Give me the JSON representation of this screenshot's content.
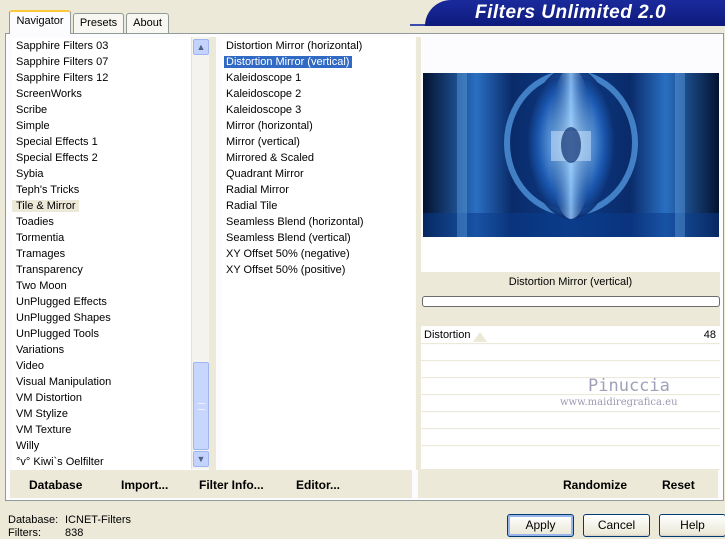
{
  "tabs": [
    {
      "label": "Navigator"
    },
    {
      "label": "Presets"
    },
    {
      "label": "About"
    }
  ],
  "banner": {
    "title": "Filters Unlimited 2.0"
  },
  "categories": [
    "Sapphire Filters 03",
    "Sapphire Filters 07",
    "Sapphire Filters 12",
    "ScreenWorks",
    "Scribe",
    "Simple",
    "Special Effects 1",
    "Special Effects 2",
    "Sybia",
    "Teph's Tricks",
    "Tile & Mirror",
    "Toadies",
    "Tormentia",
    "Tramages",
    "Transparency",
    "Two Moon",
    "UnPlugged Effects",
    "UnPlugged Shapes",
    "UnPlugged Tools",
    "Variations",
    "Video",
    "Visual Manipulation",
    "VM Distortion",
    "VM Stylize",
    "VM Texture",
    "Willy",
    "°v° Kiwi`s Oelfilter"
  ],
  "selected_category": "Tile & Mirror",
  "filters": [
    "Distortion Mirror (horizontal)",
    "Distortion Mirror (vertical)",
    "Kaleidoscope 1",
    "Kaleidoscope 2",
    "Kaleidoscope 3",
    "Mirror (horizontal)",
    "Mirror (vertical)",
    "Mirrored & Scaled",
    "Quadrant Mirror",
    "Radial Mirror",
    "Radial Tile",
    "Seamless Blend (horizontal)",
    "Seamless Blend (vertical)",
    "XY Offset 50% (negative)",
    "XY Offset 50% (positive)"
  ],
  "selected_filter": "Distortion Mirror (vertical)",
  "preview": {
    "filter_name": "Distortion Mirror (vertical)",
    "progress": 0
  },
  "params": [
    {
      "label": "Distortion",
      "value": "48"
    }
  ],
  "watermark": {
    "line1": "Pinuccia",
    "line2": "www.maidiregrafica.eu"
  },
  "toolbar": {
    "database": "Database",
    "import": "Import...",
    "filter_info": "Filter Info...",
    "editor": "Editor...",
    "randomize": "Randomize",
    "reset": "Reset"
  },
  "status": {
    "database_label": "Database:",
    "database_value": "ICNET-Filters",
    "filters_label": "Filters:",
    "filters_value": "838"
  },
  "buttons": {
    "apply": "Apply",
    "cancel": "Cancel",
    "help": "Help"
  },
  "colors": {
    "accent": "#316ac5",
    "banner": "#0e1b7c",
    "tab_highlight": "#ffc83c"
  }
}
